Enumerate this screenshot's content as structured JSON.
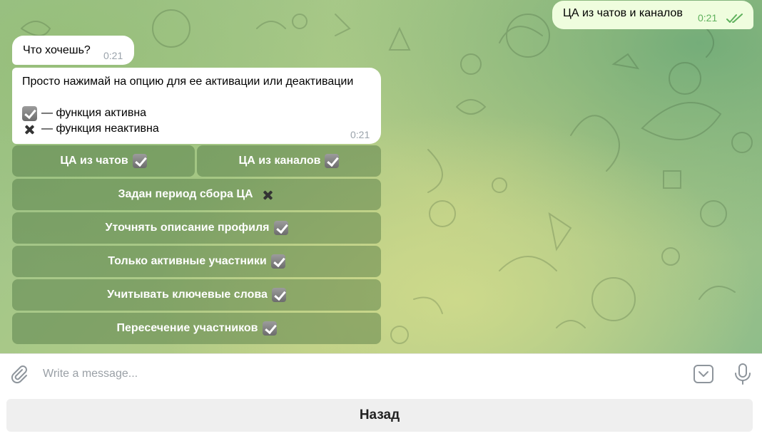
{
  "outgoing": {
    "text": "ЦА из чатов и каналов",
    "time": "0:21"
  },
  "messages": [
    {
      "text": "Что хочешь?",
      "time": "0:21"
    },
    {
      "line1": "Просто нажимай на опцию для ее активации или деактивации",
      "legend_active": "— функция активна",
      "legend_inactive": "— функция неактивна",
      "time": "0:21"
    }
  ],
  "keyboard": {
    "rows": [
      [
        {
          "label": "ЦА из чатов",
          "state": "active"
        },
        {
          "label": "ЦА из каналов",
          "state": "active"
        }
      ],
      [
        {
          "label": "Задан период сбора ЦА",
          "state": "inactive"
        }
      ],
      [
        {
          "label": "Уточнять описание профиля",
          "state": "active"
        }
      ],
      [
        {
          "label": "Только активные участники",
          "state": "active"
        }
      ],
      [
        {
          "label": "Учитывать ключевые слова",
          "state": "active"
        }
      ],
      [
        {
          "label": "Пересечение участников",
          "state": "active"
        }
      ]
    ]
  },
  "composer": {
    "placeholder": "Write a message...",
    "attach_icon": "paperclip-icon",
    "keyboard_icon": "bot-keyboard-icon",
    "mic_icon": "microphone-icon"
  },
  "reply_keyboard": {
    "back_label": "Назад"
  },
  "colors": {
    "outgoing_bubble": "#effdde",
    "incoming_bubble": "#ffffff",
    "time_outgoing": "#5fb15d",
    "inline_button_bg": "rgba(70,110,60,0.42)"
  }
}
